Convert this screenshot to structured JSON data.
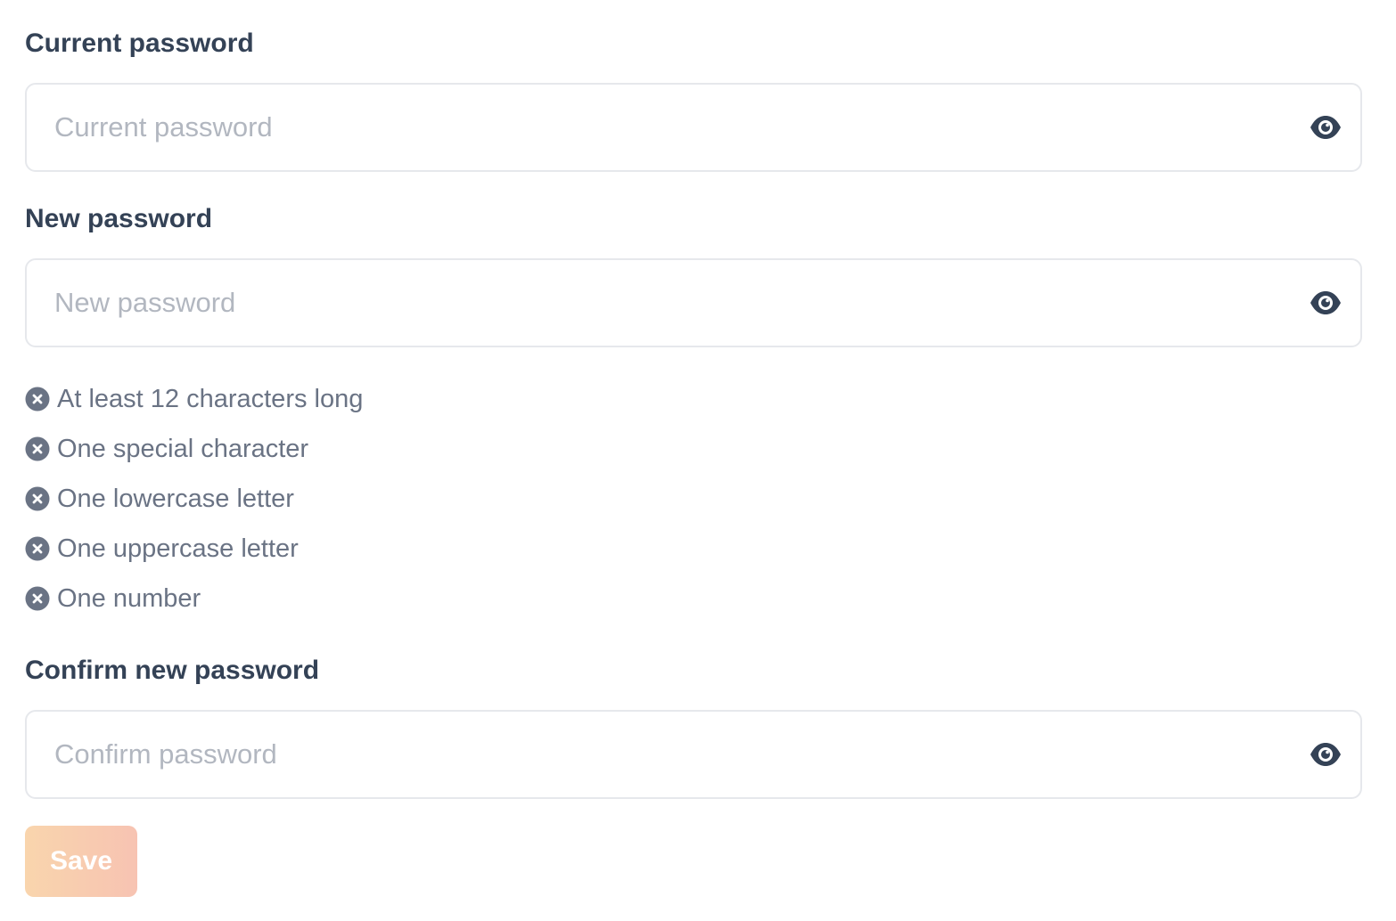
{
  "fields": {
    "current": {
      "label": "Current password",
      "placeholder": "Current password",
      "value": "",
      "toggle_icon": "eye-icon"
    },
    "new": {
      "label": "New password",
      "placeholder": "New password",
      "value": "",
      "toggle_icon": "eye-icon"
    },
    "confirm": {
      "label": "Confirm new password",
      "placeholder": "Confirm password",
      "value": "",
      "toggle_icon": "eye-icon"
    }
  },
  "requirements": [
    {
      "text": "At least 12 characters long",
      "met": false,
      "icon": "x-circle-icon"
    },
    {
      "text": "One special character",
      "met": false,
      "icon": "x-circle-icon"
    },
    {
      "text": "One lowercase letter",
      "met": false,
      "icon": "x-circle-icon"
    },
    {
      "text": "One uppercase letter",
      "met": false,
      "icon": "x-circle-icon"
    },
    {
      "text": "One number",
      "met": false,
      "icon": "x-circle-icon"
    }
  ],
  "save_button": {
    "label": "Save",
    "disabled": true
  },
  "colors": {
    "label": "#344256",
    "placeholder": "#b2b7c0",
    "rule_text": "#6a7384",
    "rule_icon": "#6a7384",
    "input_border": "#e6e8ec",
    "eye_icon": "#344256",
    "save_gradient_start": "#f9d5ad",
    "save_gradient_end": "#f7c3b2"
  }
}
